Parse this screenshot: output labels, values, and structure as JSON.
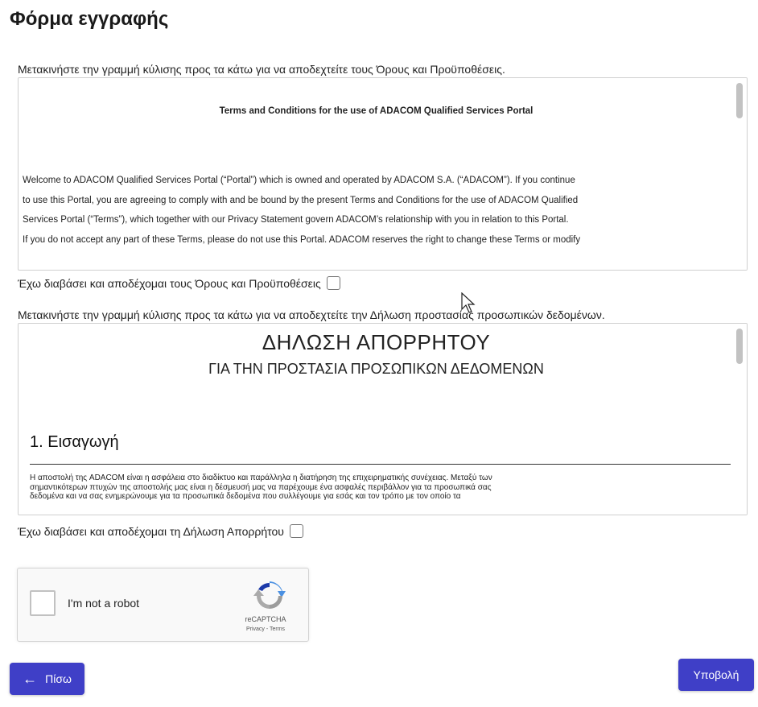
{
  "page": {
    "title": "Φόρμα εγγραφής"
  },
  "terms": {
    "instruction": "Μετακινήστε την γραμμή κύλισης προς τα κάτω για να αποδεχτείτε τους Όρους και Προϋποθέσεις.",
    "doc_title": "Terms and Conditions for the use of ADACOM Qualified Services Portal",
    "lines": [
      "Welcome to ADACOM Qualified Services Portal (“Portal”) which is owned and operated by ADACOM S.A. (“ADACOM”). If you continue",
      "to use this Portal, you are agreeing to comply with and be bound by the present Terms and Conditions for the use of ADACOM Qualified",
      "Services Portal (“Terms”), which together with our Privacy Statement govern ADACOM’s relationship with you in relation to this Portal.",
      "If you do not accept any part of these Terms, please do not use this Portal. ADACOM reserves the right to change these Terms or modify"
    ],
    "accept_label": "Έχω διαβάσει και αποδέχομαι τους Όρους και Προϋποθέσεις",
    "accepted": false
  },
  "privacy": {
    "instruction": "Μετακινήστε την γραμμή κύλισης προς τα κάτω για να αποδεχτείτε την Δήλωση προστασίας προσωπικών δεδομένων.",
    "heading": "ΔΗΛΩΣΗ ΑΠΟΡΡΗΤΟΥ",
    "subheading": "ΓΙΑ ΤΗΝ ΠΡΟΣΤΑΣΙΑ ΠΡΟΣΩΠΙΚΩΝ ΔΕΔΟΜΕΝΩΝ",
    "section_title": "1. Εισαγωγή",
    "lines": [
      "Η αποστολή της ADACOM είναι η ασφάλεια στο διαδίκτυο και παράλληλα η διατήρηση της επιχειρηματικής συνέχειας. Μεταξύ των",
      "σημαντικότερων πτυχών της αποστολής μας είναι η δέσμευσή μας να παρέχουμε ένα ασφαλές περιβάλλον για τα προσωπικά σας",
      "δεδομένα και να σας ενημερώνουμε για τα προσωπικά δεδομένα που συλλέγουμε για εσάς και τον τρόπο με τον οποίο τα"
    ],
    "accept_label": "Έχω διαβάσει και αποδέχομαι τη Δήλωση Απορρήτου",
    "accepted": false
  },
  "recaptcha": {
    "label": "I'm not a robot",
    "brand": "reCAPTCHA",
    "links": "Privacy - Terms"
  },
  "actions": {
    "back_label": "Πίσω",
    "back_icon": "arrow-left-icon",
    "submit_label": "Υποβολή",
    "color": "#3f3fc7"
  }
}
